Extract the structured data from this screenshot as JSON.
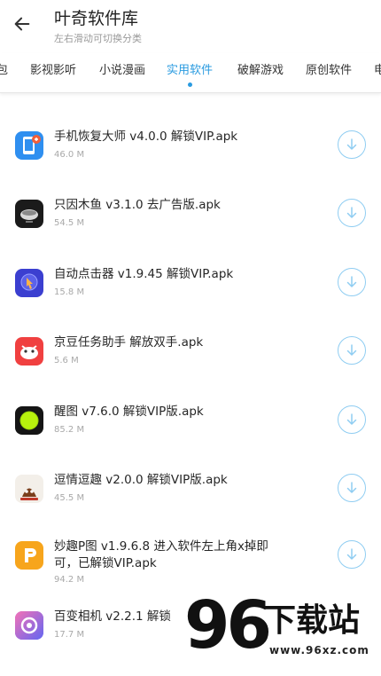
{
  "header": {
    "title": "叶奇软件库",
    "subtitle": "左右滑动可切换分类"
  },
  "tabs": [
    {
      "label": "包"
    },
    {
      "label": "影视影听"
    },
    {
      "label": "小说漫画"
    },
    {
      "label": "实用软件",
      "active": true
    },
    {
      "label": "破解游戏"
    },
    {
      "label": "原创软件"
    },
    {
      "label": "电"
    }
  ],
  "apps": [
    {
      "name": "手机恢复大师 v4.0.0 解锁VIP.apk",
      "size": "46.0 M",
      "icon": "phone-recovery-icon"
    },
    {
      "name": "只因木鱼 v3.1.0 去广告版.apk",
      "size": "54.5 M",
      "icon": "wooden-fish-icon"
    },
    {
      "name": "自动点击器 v1.9.45 解锁VIP.apk",
      "size": "15.8 M",
      "icon": "auto-clicker-icon"
    },
    {
      "name": "京豆任务助手 解放双手.apk",
      "size": "5.6 M",
      "icon": "jd-bean-icon"
    },
    {
      "name": "醒图 v7.6.0 解锁VIP版.apk",
      "size": "85.2 M",
      "icon": "xingtu-icon"
    },
    {
      "name": "逗情逗趣 v2.0.0 解锁VIP版.apk",
      "size": "45.5 M",
      "icon": "douqing-icon"
    },
    {
      "name": "妙趣P图 v1.9.6.8 进入软件左上角x掉即可，已解锁VIP.apk",
      "size": "94.2 M",
      "icon": "miaoqu-ptu-icon"
    },
    {
      "name": "百变相机 v2.2.1 解锁",
      "size": "17.7 M",
      "icon": "camera-icon"
    }
  ],
  "watermark": {
    "number": "96",
    "text": "下载站",
    "url": "www.96xz.com"
  },
  "colors": {
    "accent": "#2a9be0",
    "download_ring": "#8fcdf2"
  }
}
